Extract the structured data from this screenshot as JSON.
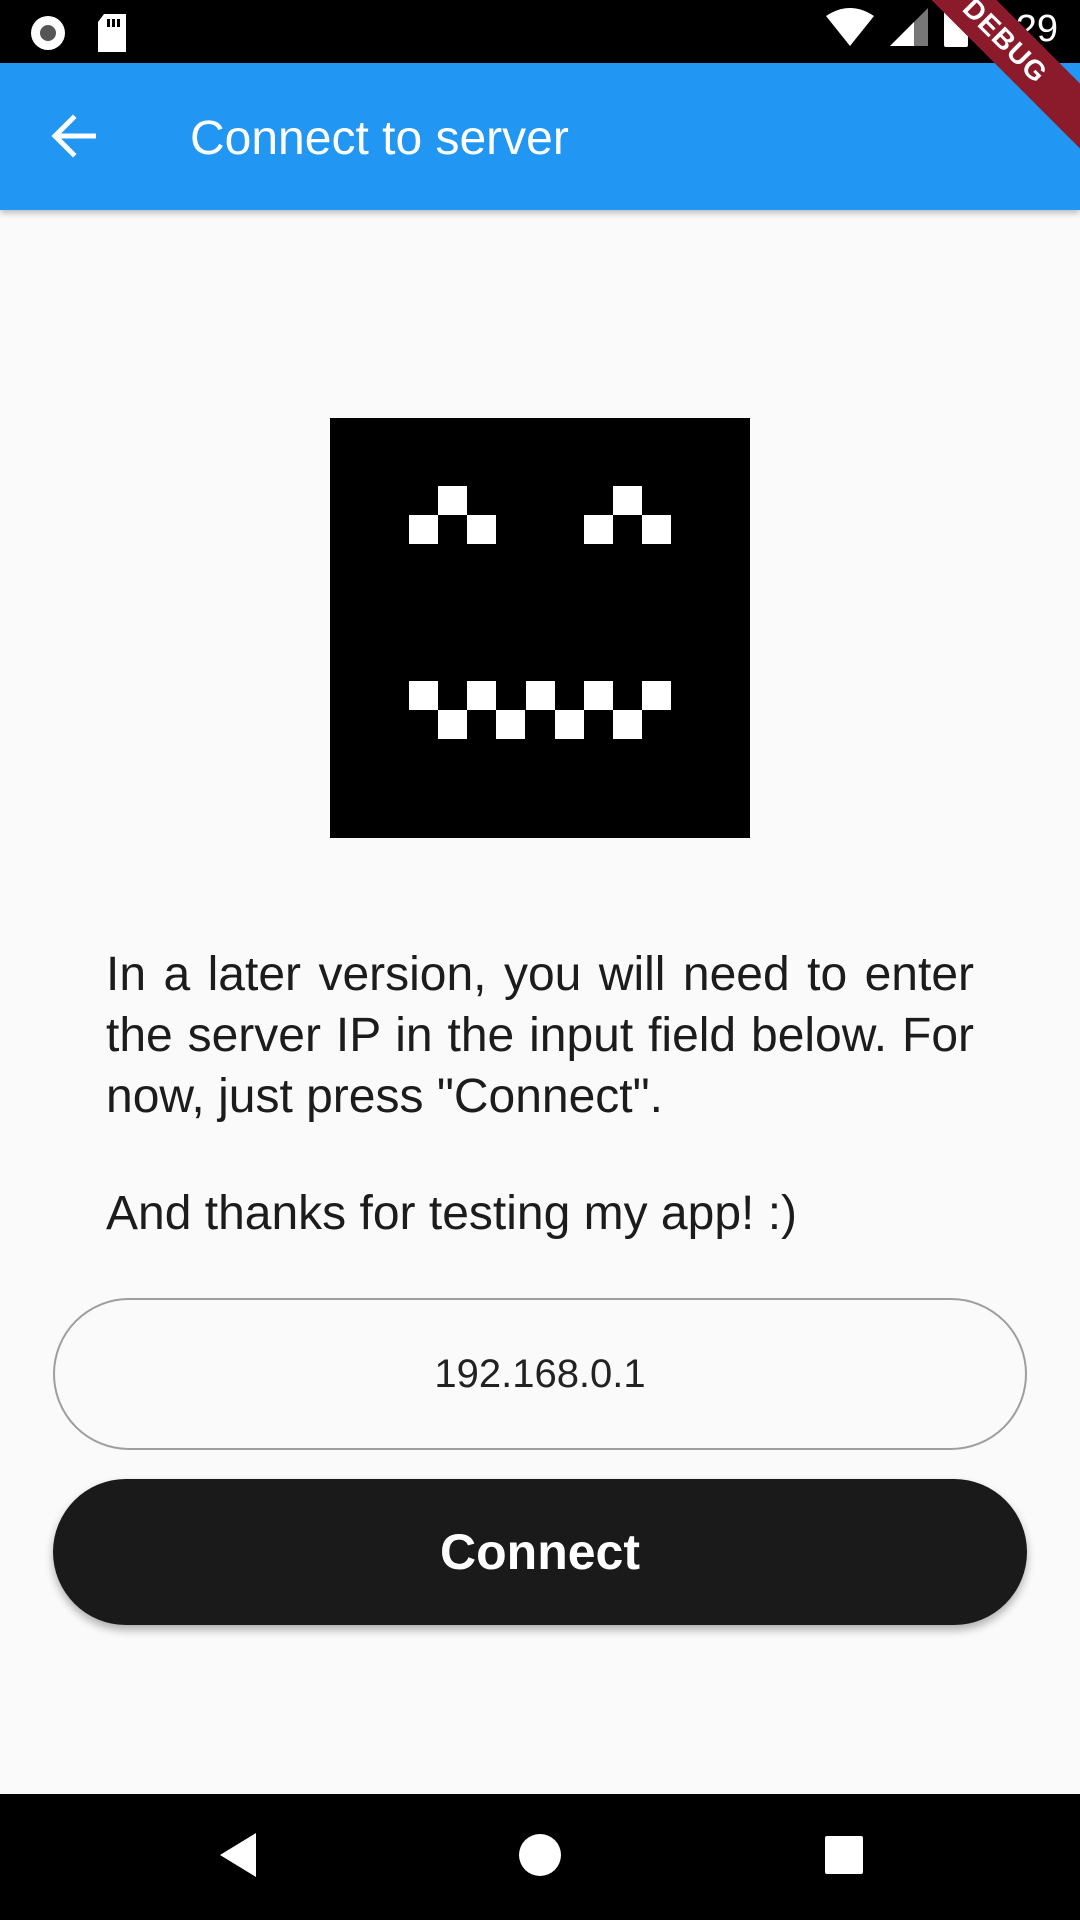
{
  "status_bar": {
    "time": "6:29",
    "icons": [
      "record-icon",
      "sd-card-icon",
      "wifi-icon",
      "signal-icon",
      "battery-icon"
    ]
  },
  "debug_banner": "DEBUG",
  "app_bar": {
    "title": "Connect to server",
    "back_icon": "arrow-back-icon",
    "color": "#2196f3"
  },
  "content": {
    "description": "In a later version, you will need to enter the server IP in the input field below. For now, just press \"Connect\".",
    "thanks": "And thanks for testing my app! :)",
    "ip_input": {
      "value": "192.168.0.1"
    },
    "connect_button": "Connect"
  },
  "nav_bar": {
    "icons": [
      "back-triangle-icon",
      "home-circle-icon",
      "recents-square-icon"
    ]
  }
}
